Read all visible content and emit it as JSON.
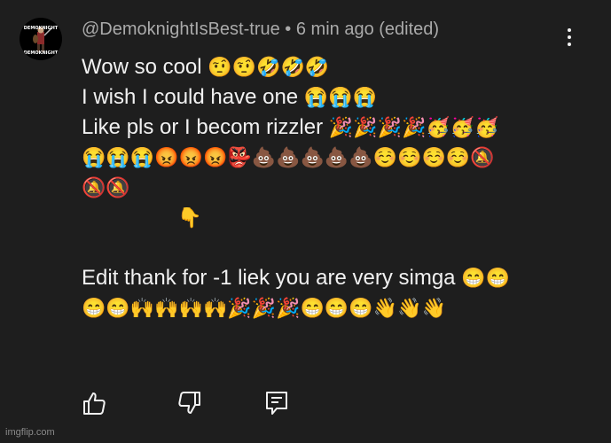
{
  "comment": {
    "author": "@DemoknightIsBest-true",
    "separator": "•",
    "time": "6 min ago (edited)",
    "lines": [
      {
        "text": "Wow so cool",
        "emoji": "🤨🤨🤣🤣🤣"
      },
      {
        "text": "I wish I could have one",
        "emoji": "😭😭😭"
      },
      {
        "text": "Like pls or I becom rizzler",
        "emoji": "🎉🎉🎉🎉🥳🥳🥳"
      },
      {
        "text": "",
        "emoji": "😭😭😭😡😡😡👺💩💩💩💩💩☺️☺️☺️☺️🔕"
      },
      {
        "text": "",
        "emoji": "🔕🔕"
      },
      {
        "text": "",
        "emoji": "👇"
      },
      {
        "text": "",
        "emoji": ""
      },
      {
        "text": "Edit thank for -1 liek you are very simga",
        "emoji": "😁😁"
      },
      {
        "text": "",
        "emoji": "😁😁🙌🙌🙌🙌🎉🎉🎉😁😁😁👋👋👋"
      }
    ]
  },
  "avatar": {
    "banner_top": "DEMOKNIGHT",
    "banner_bottom": "DEMOKNIGHT"
  },
  "actions": {
    "like_icon": "thumbs-up-icon",
    "dislike_icon": "thumbs-down-icon",
    "reply_icon": "comment-reply-icon"
  },
  "watermark": "imgflip.com"
}
